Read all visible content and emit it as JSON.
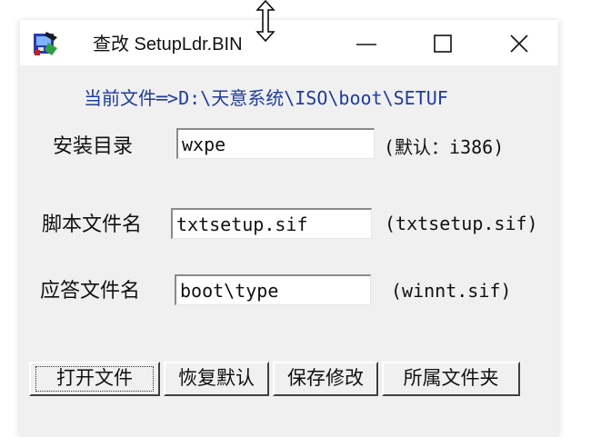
{
  "window": {
    "title": "查改 SetupLdr.BIN",
    "icons": {
      "app": "app-icon",
      "minimize": "minimize-icon",
      "maximize": "maximize-icon",
      "close": "close-icon",
      "cursor": "resize-vertical-cursor-icon"
    }
  },
  "current_file": "当前文件═>D:\\天意系统\\ISO\\boot\\SETUF",
  "form": {
    "install_dir": {
      "label": "安装目录",
      "value": "wxpe",
      "hint": "(默认：i386)"
    },
    "script_file": {
      "label": "脚本文件名",
      "value": "txtsetup.sif",
      "hint": "(txtsetup.sif)"
    },
    "answer_file": {
      "label": "应答文件名",
      "value": "boot\\type",
      "hint": "(winnt.sif)"
    }
  },
  "buttons": {
    "open_file": "打开文件",
    "restore_default": "恢复默认",
    "save_changes": "保存修改",
    "containing_folder": "所属文件夹"
  },
  "colors": {
    "accent_text": "#1f3c9e",
    "window_bg": "#f0f0f0"
  }
}
